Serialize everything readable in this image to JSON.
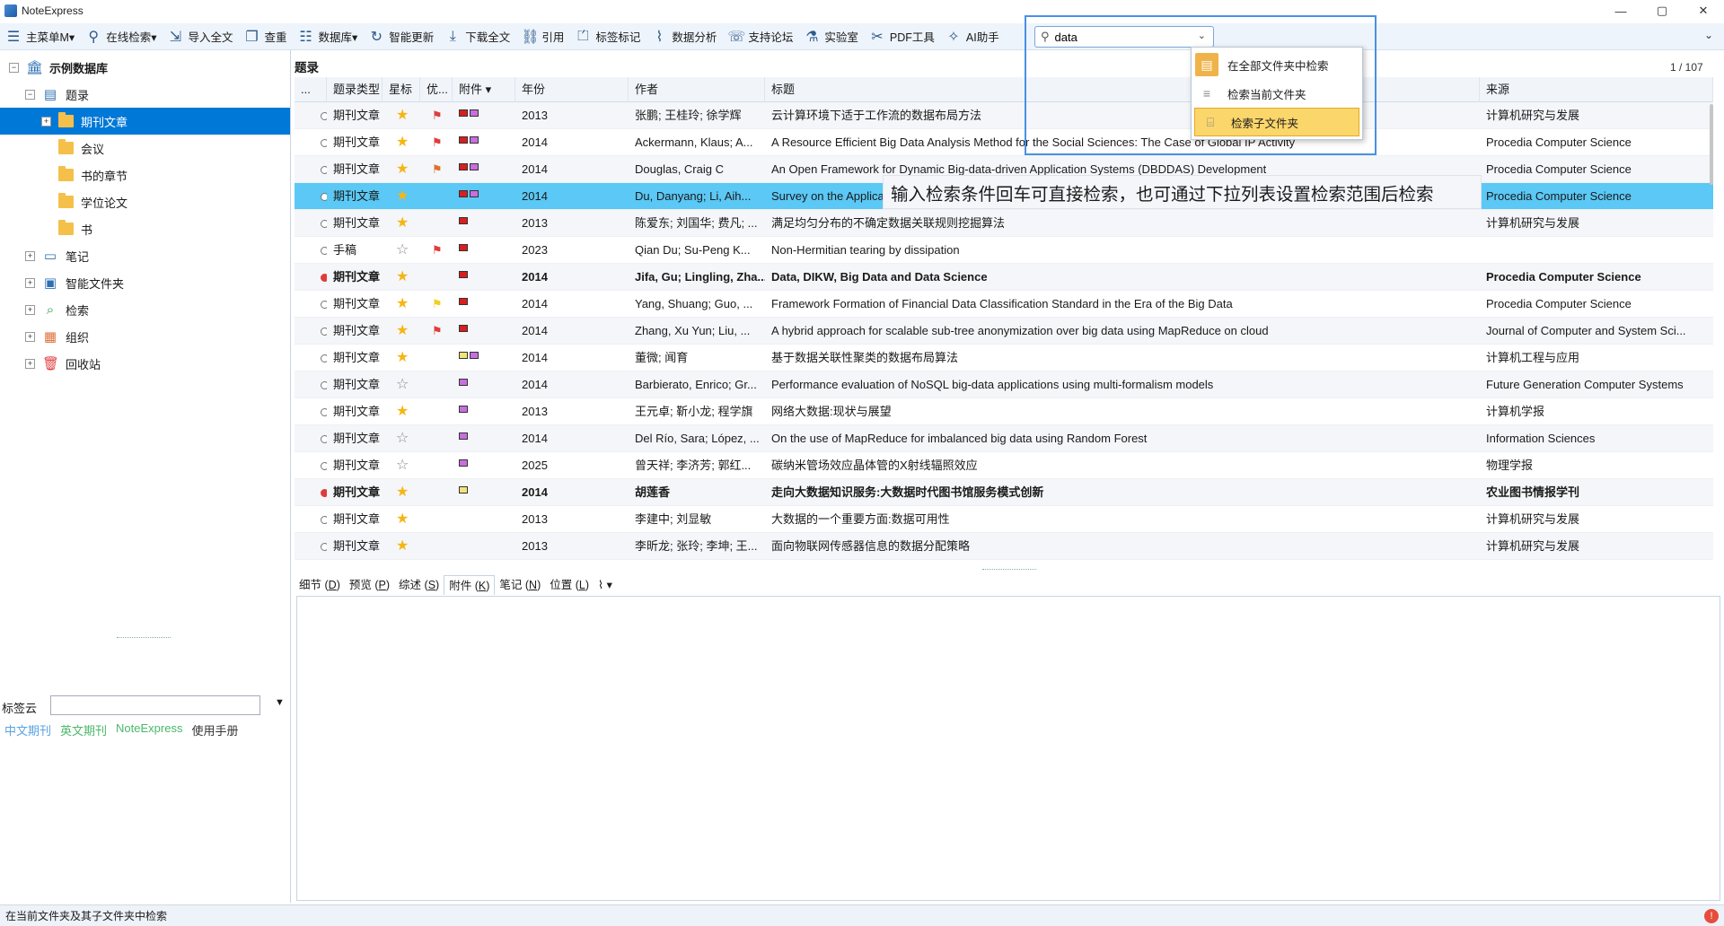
{
  "app": {
    "title": "NoteExpress"
  },
  "window": {
    "minimize": "—",
    "maximize": "▢",
    "close": "✕"
  },
  "toolbar": {
    "items": [
      {
        "icon": "menu-icon",
        "glyph": "☰",
        "label": "主菜单M▾"
      },
      {
        "icon": "search-icon",
        "glyph": "⚲",
        "label": "在线检索▾"
      },
      {
        "icon": "import-icon",
        "glyph": "⇲",
        "label": "导入全文"
      },
      {
        "icon": "duplicate-icon",
        "glyph": "❐",
        "label": "查重"
      },
      {
        "icon": "database-icon",
        "glyph": "☷",
        "label": "数据库▾"
      },
      {
        "icon": "refresh-icon",
        "glyph": "↻",
        "label": "智能更新"
      },
      {
        "icon": "download-icon",
        "glyph": "⤓",
        "label": "下载全文"
      },
      {
        "icon": "cite-icon",
        "glyph": "⛓",
        "label": "引用"
      },
      {
        "icon": "tag-icon",
        "glyph": "⏍",
        "label": "标签标记"
      },
      {
        "icon": "analysis-icon",
        "glyph": "⌇",
        "label": "数据分析"
      },
      {
        "icon": "forum-icon",
        "glyph": "☏",
        "label": "支持论坛"
      },
      {
        "icon": "lab-icon",
        "glyph": "⚗",
        "label": "实验室"
      },
      {
        "icon": "pdf-tools-icon",
        "glyph": "✂",
        "label": "PDF工具"
      },
      {
        "icon": "ai-icon",
        "glyph": "✧",
        "label": "AI助手"
      }
    ]
  },
  "search": {
    "value": "data"
  },
  "search_menu": {
    "items": [
      {
        "label": "在全部文件夹中检索"
      },
      {
        "label": "检索当前文件夹"
      },
      {
        "label": "检索子文件夹"
      }
    ]
  },
  "tooltip": {
    "text": "输入检索条件回车可直接检索，也可通过下拉列表设置检索范围后检索"
  },
  "tree": {
    "root": "示例数据库",
    "items": [
      {
        "label": "题录"
      },
      {
        "label": "期刊文章"
      },
      {
        "label": "会议"
      },
      {
        "label": "书的章节"
      },
      {
        "label": "学位论文"
      },
      {
        "label": "书"
      },
      {
        "label": "笔记"
      },
      {
        "label": "智能文件夹"
      },
      {
        "label": "检索"
      },
      {
        "label": "组织"
      },
      {
        "label": "回收站"
      }
    ]
  },
  "tag_cloud": {
    "label": "标签云",
    "links": [
      {
        "text": "中文期刊",
        "color": "#5aa3e0"
      },
      {
        "text": "英文期刊",
        "color": "#4cb86a"
      },
      {
        "text": "NoteExpress",
        "color": "#49b86a"
      },
      {
        "text": "使用手册",
        "color": "#333333"
      }
    ]
  },
  "main": {
    "header": "题录",
    "page_info": "1 / 107"
  },
  "table": {
    "columns": [
      "...",
      "题录类型",
      "星标",
      "优...",
      "附件 ▾",
      "年份",
      "作者",
      "标题",
      "来源"
    ],
    "rows": [
      {
        "type": "期刊文章",
        "starred": true,
        "flag": "#e03c3c",
        "att": [
          "#d81e1e",
          "#c86ee0"
        ],
        "year": "2013",
        "author": "张鹏; 王桂玲; 徐学辉",
        "title": "云计算环境下适于工作流的数据布局方法",
        "source": "计算机研究与发展",
        "unread": false
      },
      {
        "type": "期刊文章",
        "starred": true,
        "flag": "#e03c3c",
        "att": [
          "#d81e1e",
          "#c86ee0"
        ],
        "year": "2014",
        "author": "Ackermann, Klaus; A...",
        "title": "A Resource Efficient Big Data Analysis Method for the Social Sciences: The Case of Global IP Activity",
        "source": "Procedia Computer Science",
        "unread": false
      },
      {
        "type": "期刊文章",
        "starred": true,
        "flag": "#e0702a",
        "att": [
          "#d81e1e",
          "#c86ee0"
        ],
        "year": "2014",
        "author": "Douglas, Craig C",
        "title": "An Open Framework for Dynamic Big-data-driven Application Systems (DBDDAS) Development",
        "source": "Procedia Computer Science",
        "unread": false
      },
      {
        "type": "期刊文章",
        "starred": true,
        "flag": "",
        "att": [
          "#d81e1e",
          "#c86ee0"
        ],
        "year": "2014",
        "author": "Du, Danyang; Li, Aih...",
        "title": "Survey on the Applications of Big Data in Chinese Real Estate Enterprise",
        "source": "Procedia Computer Science",
        "unread": false
      },
      {
        "type": "期刊文章",
        "starred": true,
        "flag": "",
        "att": [
          "#d81e1e"
        ],
        "year": "2013",
        "author": "陈爱东; 刘国华; 费凡; ...",
        "title": "满足均匀分布的不确定数据关联规则挖掘算法",
        "source": "计算机研究与发展",
        "unread": false
      },
      {
        "type": "手稿",
        "starred": false,
        "flag": "#e03c3c",
        "att": [
          "#d81e1e"
        ],
        "year": "2023",
        "author": "Qian Du; Su-Peng K...",
        "title": "Non-Hermitian tearing by dissipation",
        "source": "",
        "unread": false
      },
      {
        "type": "期刊文章",
        "starred": true,
        "flag": "",
        "att": [
          "#d81e1e"
        ],
        "year": "2014",
        "author": "Jifa, Gu; Lingling, Zha...",
        "title": "Data, DIKW, Big Data and Data Science",
        "source": "Procedia Computer Science",
        "unread": true
      },
      {
        "type": "期刊文章",
        "starred": true,
        "flag": "#f0d020",
        "att": [
          "#d81e1e"
        ],
        "year": "2014",
        "author": "Yang, Shuang; Guo, ...",
        "title": "Framework Formation of Financial Data Classification Standard in the Era of the Big Data",
        "source": "Procedia Computer Science",
        "unread": false
      },
      {
        "type": "期刊文章",
        "starred": true,
        "flag": "#e03c3c",
        "att": [
          "#d81e1e"
        ],
        "year": "2014",
        "author": "Zhang, Xu Yun; Liu, ...",
        "title": "A hybrid approach for scalable sub-tree anonymization over big data using MapReduce on cloud",
        "source": "Journal of Computer and System Sci...",
        "unread": false
      },
      {
        "type": "期刊文章",
        "starred": true,
        "flag": "",
        "att": [
          "#f3e27a",
          "#c86ee0"
        ],
        "year": "2014",
        "author": "董微; 闻育",
        "title": "基于数据关联性聚类的数据布局算法",
        "source": "计算机工程与应用",
        "unread": false
      },
      {
        "type": "期刊文章",
        "starred": false,
        "flag": "",
        "att": [
          "#c86ee0"
        ],
        "year": "2014",
        "author": "Barbierato, Enrico; Gr...",
        "title": "Performance evaluation of NoSQL big-data applications using multi-formalism models",
        "source": "Future Generation Computer Systems",
        "unread": false
      },
      {
        "type": "期刊文章",
        "starred": true,
        "flag": "",
        "att": [
          "#c86ee0"
        ],
        "year": "2013",
        "author": "王元卓; 靳小龙; 程学旗",
        "title": "网络大数据:现状与展望",
        "source": "计算机学报",
        "unread": false
      },
      {
        "type": "期刊文章",
        "starred": false,
        "flag": "",
        "att": [
          "#c86ee0"
        ],
        "year": "2014",
        "author": "Del Río, Sara; López, ...",
        "title": "On the use of MapReduce for imbalanced big data using Random Forest",
        "source": "Information Sciences",
        "unread": false
      },
      {
        "type": "期刊文章",
        "starred": false,
        "flag": "",
        "att": [
          "#c86ee0"
        ],
        "year": "2025",
        "author": "曾天祥; 李济芳; 郭红...",
        "title": "碳纳米管场效应晶体管的X射线辐照效应",
        "source": "物理学报",
        "unread": false
      },
      {
        "type": "期刊文章",
        "starred": true,
        "flag": "",
        "att": [
          "#f3e27a"
        ],
        "year": "2014",
        "author": "胡莲香",
        "title": "走向大数据知识服务:大数据时代图书馆服务模式创新",
        "source": "农业图书情报学刊",
        "unread": true
      },
      {
        "type": "期刊文章",
        "starred": true,
        "flag": "",
        "att": [],
        "year": "2013",
        "author": "李建中; 刘显敏",
        "title": "大数据的一个重要方面:数据可用性",
        "source": "计算机研究与发展",
        "unread": false
      },
      {
        "type": "期刊文章",
        "starred": true,
        "flag": "",
        "att": [],
        "year": "2013",
        "author": "李昕龙; 张玲; 李坤; 王...",
        "title": "面向物联网传感器信息的数据分配策略",
        "source": "计算机研究与发展",
        "unread": false
      }
    ],
    "selected_row": 3
  },
  "bottom_tabs": [
    {
      "label": "细节",
      "key": "D"
    },
    {
      "label": "预览",
      "key": "P"
    },
    {
      "label": "综述",
      "key": "S"
    },
    {
      "label": "附件",
      "key": "K"
    },
    {
      "label": "笔记",
      "key": "N"
    },
    {
      "label": "位置",
      "key": "L"
    }
  ],
  "status": {
    "text": "在当前文件夹及其子文件夹中检索",
    "alert": "!"
  }
}
